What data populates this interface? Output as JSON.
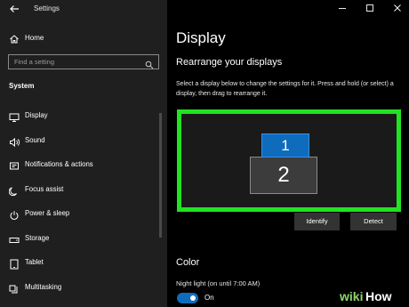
{
  "window": {
    "title": "Settings",
    "controls": [
      "minimize-icon",
      "maximize-icon",
      "close-icon"
    ]
  },
  "sidebar": {
    "home_label": "Home",
    "search_placeholder": "Find a setting",
    "section_title": "System",
    "items": [
      {
        "label": "Display",
        "icon": "display-icon"
      },
      {
        "label": "Sound",
        "icon": "sound-icon"
      },
      {
        "label": "Notifications & actions",
        "icon": "notifications-icon"
      },
      {
        "label": "Focus assist",
        "icon": "focus-assist-icon"
      },
      {
        "label": "Power & sleep",
        "icon": "power-icon"
      },
      {
        "label": "Storage",
        "icon": "storage-icon"
      },
      {
        "label": "Tablet",
        "icon": "tablet-icon"
      },
      {
        "label": "Multitasking",
        "icon": "multitasking-icon"
      }
    ]
  },
  "main": {
    "page_title": "Display",
    "subheading": "Rearrange your displays",
    "description": "Select a display below to change the settings for it. Press and hold (or select) a display, then drag to rearrange it.",
    "monitors": [
      {
        "number": "1",
        "selected": true
      },
      {
        "number": "2",
        "selected": false
      }
    ],
    "identify_label": "Identify",
    "detect_label": "Detect",
    "color_heading": "Color",
    "night_light_label": "Night light (on until 7:00 AM)",
    "night_light_state": "On"
  },
  "colors": {
    "highlight_border": "#21e321",
    "accent": "#0f6cbd",
    "sidebar_bg": "#1f1f1f",
    "main_bg": "#000000"
  },
  "watermark": {
    "text": "wikiHow"
  }
}
